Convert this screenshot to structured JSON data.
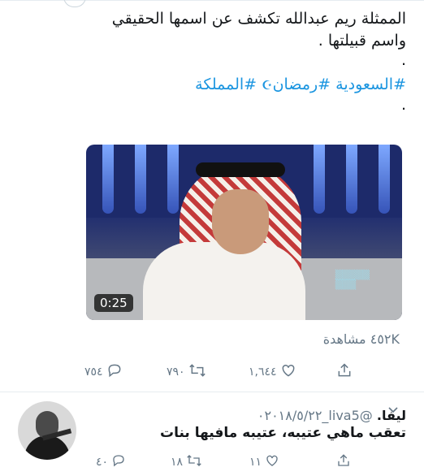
{
  "tweet": {
    "line1": "الممثلة ريم عبدالله تكشف عن اسمها الحقيقي",
    "line2": "واسم قبيلتها .",
    "dot1": ".",
    "hashtag1": "#السعودية",
    "hashtag2": "#رمضان",
    "hashtag3": "#المملكة",
    "dot2": ".",
    "video_duration": "0:25",
    "views": "٤٥٢K مشاهدة",
    "reply_count": "٧٥٤",
    "retweet_count": "٧٩٠",
    "like_count": "١,٦٤٤"
  },
  "reply": {
    "name": "ليفا.",
    "handle_date": "@liva5_٠٢٠١٨/٥/٢٢",
    "text": "تعقب ماهي عتيبه، عتيبه مافيها بنات",
    "reply_count": "٤٠",
    "retweet_count": "١٨",
    "like_count": "١١"
  },
  "icons": {
    "reply": "reply-icon",
    "retweet": "retweet-icon",
    "like": "heart-icon",
    "share": "share-icon",
    "chevron": "chevron-down-icon",
    "crescent": "crescent-moon-icon"
  },
  "colors": {
    "link": "#1b95e0",
    "muted": "#657786",
    "text": "#14171a"
  }
}
